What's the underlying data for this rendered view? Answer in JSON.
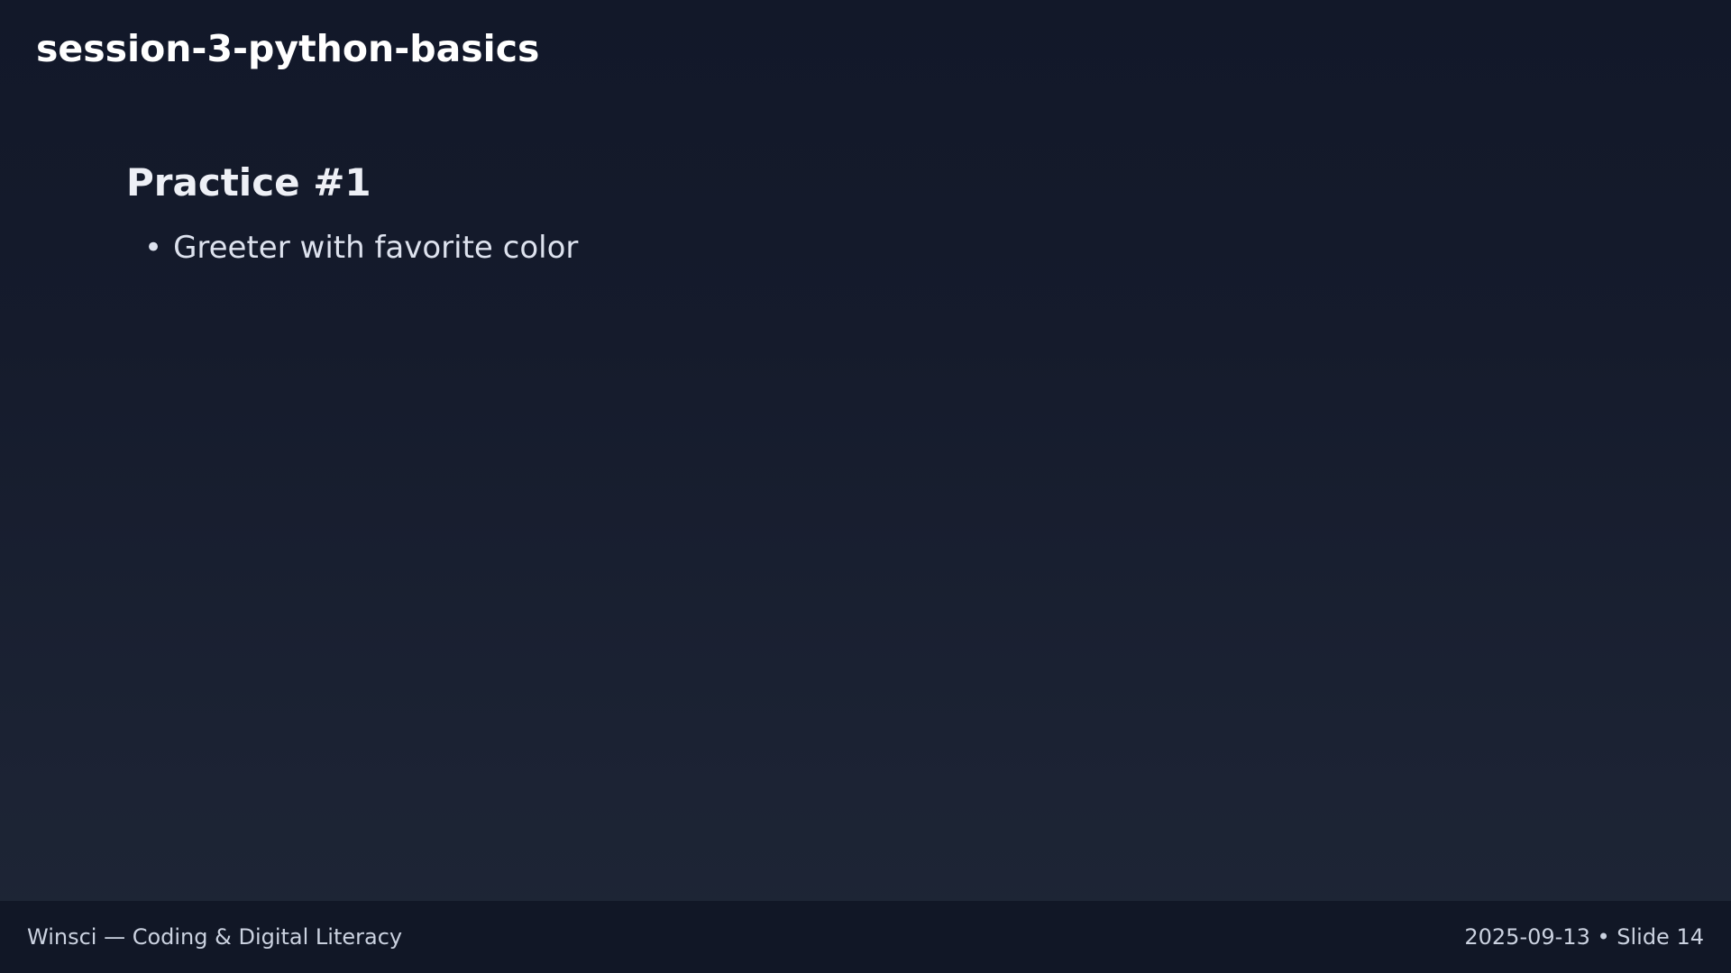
{
  "deck": {
    "title": "session-3-python-basics"
  },
  "slide": {
    "heading": "Practice #1",
    "bullets": [
      {
        "marker": "•",
        "text": "Greeter with favorite color"
      }
    ]
  },
  "footer": {
    "left_text": "Winsci — Coding & Digital Literacy",
    "right_text": "2025-09-13 • Slide 14"
  },
  "colors": {
    "background_top": "#121829",
    "background_bottom": "#1e2636",
    "footer_background": "#111726",
    "title_text": "#ffffff",
    "body_text": "#dde2ee"
  }
}
